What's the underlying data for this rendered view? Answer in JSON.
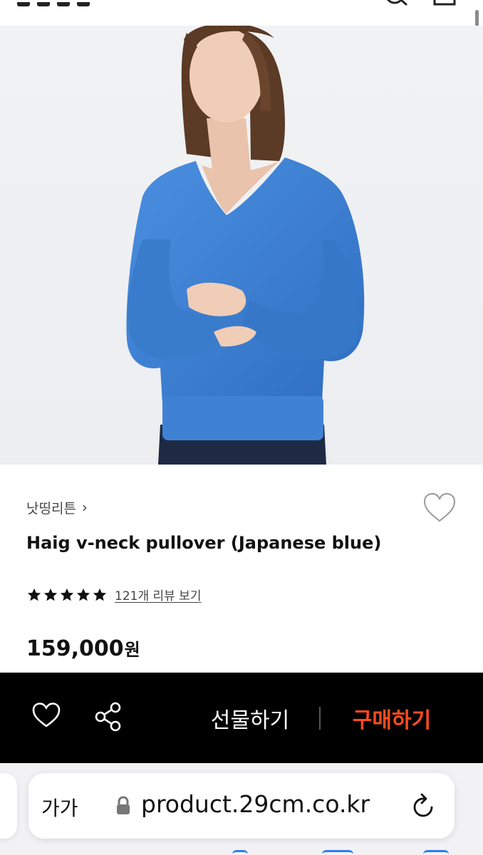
{
  "product": {
    "brand": "낫띵리튼",
    "title": "Haig v-neck pullover (Japanese blue)",
    "rating_stars": 5,
    "review_link": "121개 리뷰 보기",
    "price": "159,000",
    "currency": "원",
    "image": {
      "subject": "model wearing blue v-neck sweater",
      "sweater_color": "#3f82d4",
      "background_color": "#eef0f2"
    }
  },
  "buy_bar": {
    "gift_label": "선물하기",
    "buy_label": "구매하기",
    "buy_color": "#ff4b1f"
  },
  "browser": {
    "text_size_label": "가가",
    "url": "product.29cm.co.kr"
  },
  "icons": [
    "search-icon",
    "cart-icon",
    "heart-icon",
    "share-icon",
    "lock-icon",
    "reload-icon",
    "chevron-right-icon",
    "star-icon"
  ]
}
